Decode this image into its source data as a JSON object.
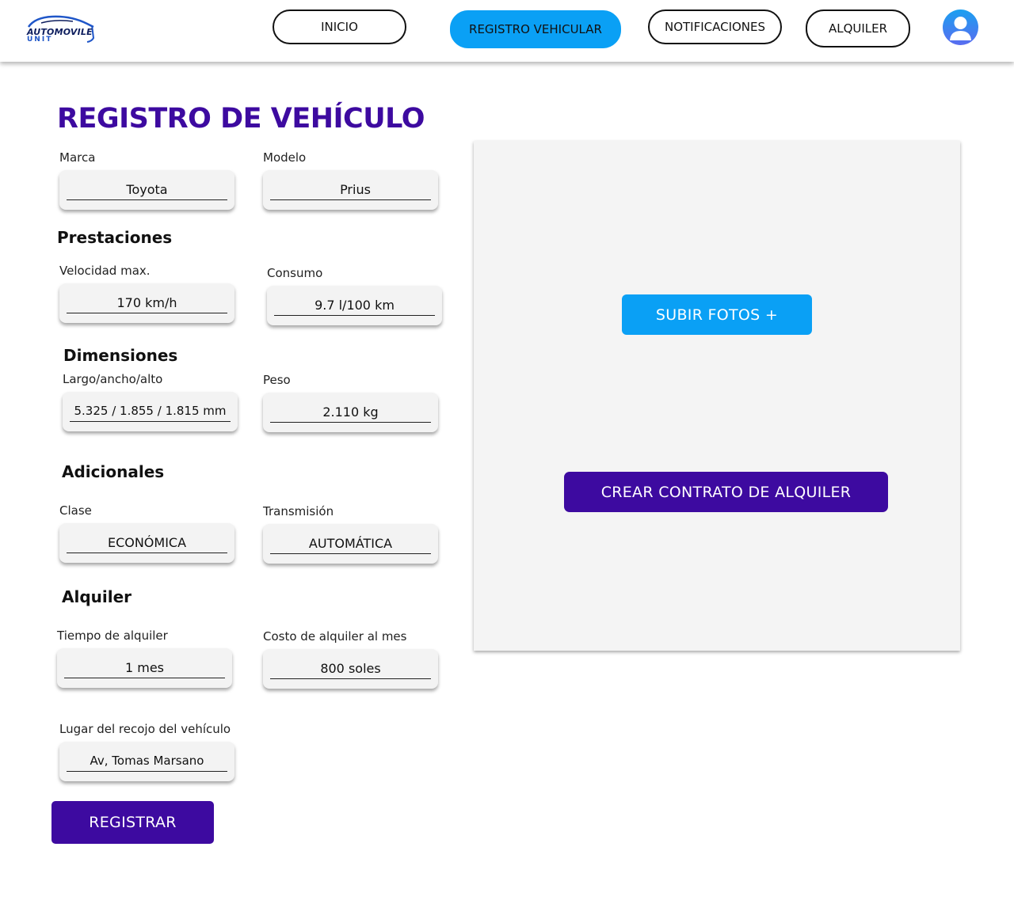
{
  "header": {
    "logo_line1": "AUTOMOVILE",
    "logo_line2": "UNIT",
    "nav": [
      {
        "label": "INICIO"
      },
      {
        "label": "REGISTRO VEHICULAR"
      },
      {
        "label": "NOTIFICACIONES"
      },
      {
        "label": "ALQUILER"
      }
    ],
    "active_nav": "REGISTRO VEHICULAR",
    "accent_color": "#0aa0f5"
  },
  "form": {
    "title": "REGISTRO DE VEHÍCULO",
    "marca": {
      "label": "Marca",
      "value": "Toyota"
    },
    "modelo": {
      "label": "Modelo",
      "value": "Prius"
    },
    "prestaciones": {
      "heading": "Prestaciones",
      "velocidad": {
        "label": "Velocidad max.",
        "value": "170 km/h"
      },
      "consumo": {
        "label": "Consumo",
        "value": "9.7 l/100 km"
      }
    },
    "dimensiones": {
      "heading": "Dimensiones",
      "medidas": {
        "label": "Largo/ancho/alto",
        "value": "5.325 / 1.855 / 1.815 mm"
      },
      "peso": {
        "label": "Peso",
        "value": "2.110 kg"
      }
    },
    "adicionales": {
      "heading": "Adicionales",
      "clase": {
        "label": "Clase",
        "value": "ECONÓMICA"
      },
      "transmision": {
        "label": "Transmisión",
        "value": "AUTOMÁTICA"
      }
    },
    "alquiler": {
      "heading": "Alquiler",
      "tiempo": {
        "label": "Tiempo de alquiler",
        "value": "1 mes"
      },
      "costo": {
        "label": "Costo de alquiler al mes",
        "value": "800 soles"
      }
    },
    "recojo": {
      "label": "Lugar del recojo del vehículo",
      "value": "Av, Tomas Marsano"
    },
    "register_label": "REGISTRAR",
    "primary_color": "#3d0aa0"
  },
  "photos": {
    "upload_label": "SUBIR FOTOS +",
    "contract_label": "CREAR CONTRATO DE ALQUILER"
  }
}
